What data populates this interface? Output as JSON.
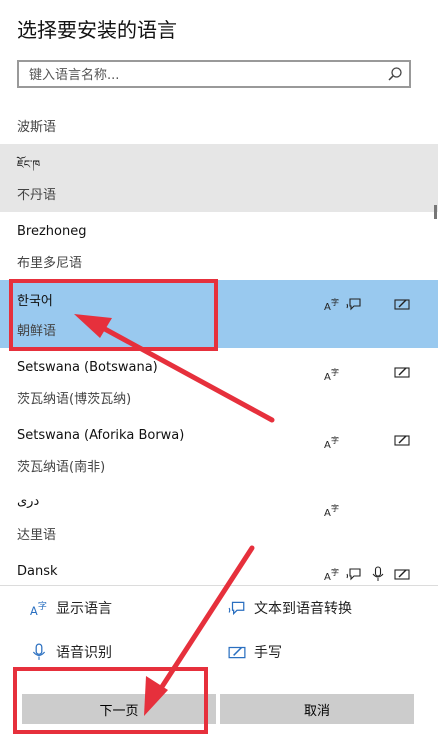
{
  "dialog": {
    "title": "选择要安装的语言"
  },
  "search": {
    "placeholder": "键入语言名称..."
  },
  "languages": [
    {
      "name": "",
      "sub": "波斯语"
    },
    {
      "name": "ཇོང་ཁ",
      "sub": "不丹语"
    },
    {
      "name": "Brezhoneg",
      "sub": "布里多尼语"
    },
    {
      "name": "한국어",
      "sub": "朝鲜语"
    },
    {
      "name": "Setswana (Botswana)",
      "sub": "茨瓦纳语(博茨瓦纳)"
    },
    {
      "name": "Setswana (Aforika Borwa)",
      "sub": "茨瓦纳语(南非)"
    },
    {
      "name": "دری",
      "sub": "达里语"
    },
    {
      "name": "Dansk",
      "sub": ""
    }
  ],
  "legend": {
    "display": "显示语言",
    "tts": "文本到语音转换",
    "speech": "语音识别",
    "handwriting": "手写"
  },
  "buttons": {
    "next": "下一页",
    "cancel": "取消"
  }
}
